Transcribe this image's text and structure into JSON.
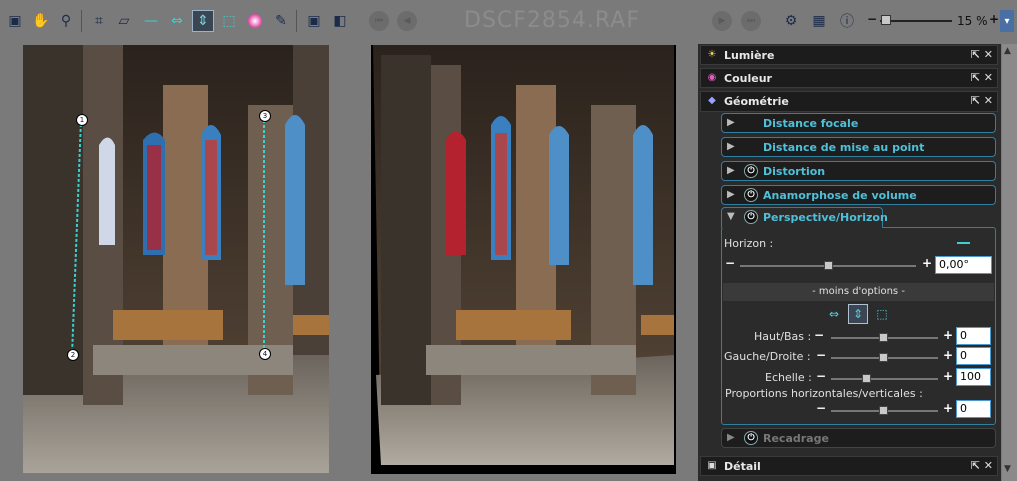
{
  "toolbar": {
    "title": "DSCF2854.RAF",
    "zoom": "15 %",
    "zoom_level": 0.15
  },
  "panels": {
    "lumiere": "Lumière",
    "couleur": "Couleur",
    "geometrie": "Géométrie",
    "detail": "Détail"
  },
  "geometry": {
    "distance_focale": "Distance focale",
    "distance_mise_au_point": "Distance de mise au point",
    "distortion": "Distortion",
    "anamorphose": "Anamorphose de volume",
    "perspective": "Perspective/Horizon",
    "recadrage": "Recadrage"
  },
  "perspective": {
    "horizon_label": "Horizon :",
    "horizon_value": "0,00°",
    "moins_options": "- moins d'options -",
    "haut_bas_label": "Haut/Bas :",
    "haut_bas_value": "0",
    "gauche_droite_label": "Gauche/Droite :",
    "gauche_droite_value": "0",
    "echelle_label": "Echelle :",
    "echelle_value": "100",
    "proportions_label": "Proportions horizontales/verticales :",
    "proportions_value": "0"
  },
  "guides": {
    "p1": "1",
    "p2": "2",
    "p3": "3",
    "p4": "4"
  },
  "colors": {
    "accent": "#4fc0da",
    "guide": "#3ad1d1",
    "panel_bg": "#2b2b2b"
  }
}
